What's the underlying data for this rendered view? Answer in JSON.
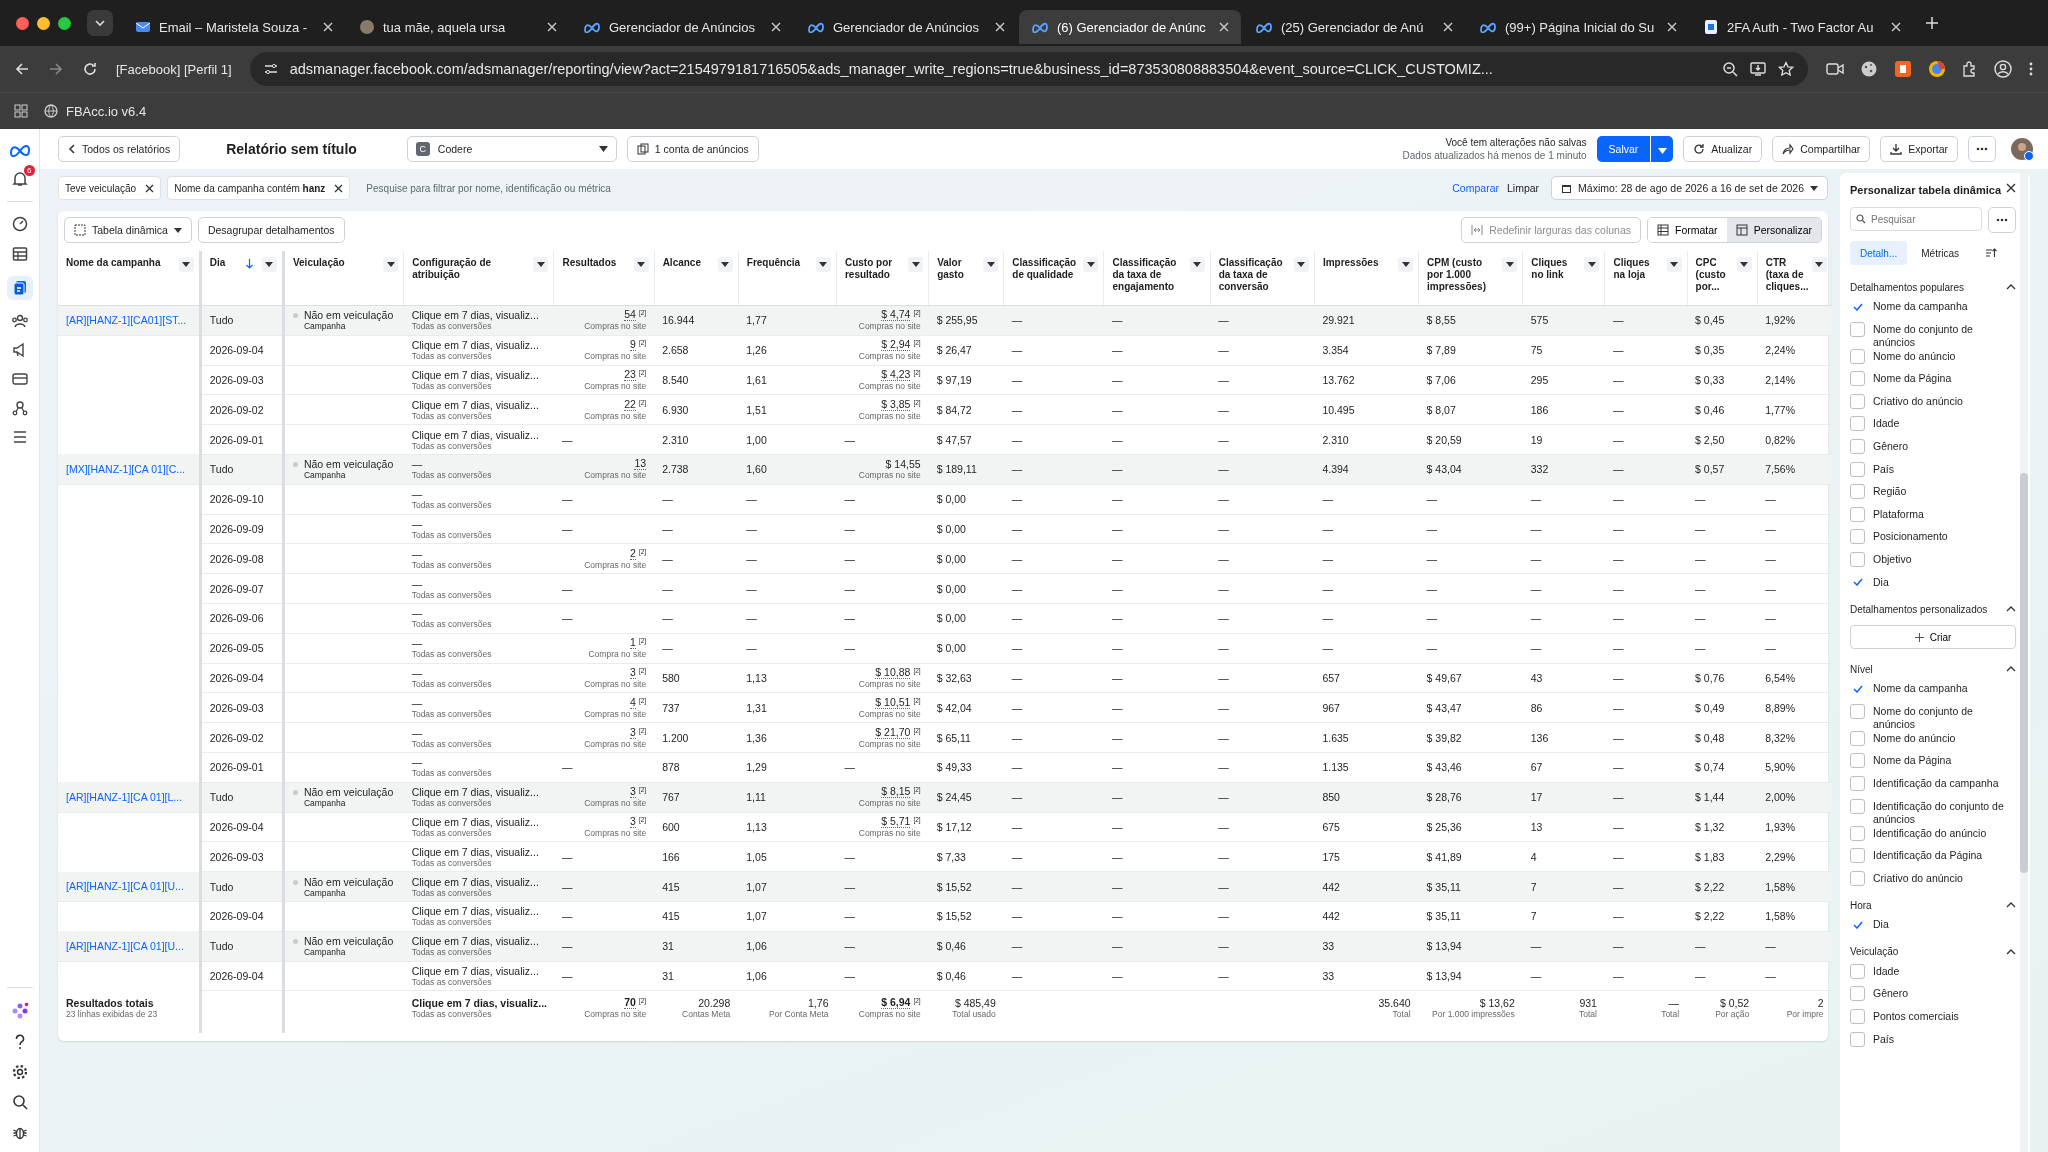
{
  "browser": {
    "tabs": [
      {
        "title": "Email – Maristela Souza -",
        "selected": false
      },
      {
        "title": "tua mãe, aquela ursa",
        "selected": false
      },
      {
        "title": "Gerenciador de Anúncios",
        "selected": false
      },
      {
        "title": "Gerenciador de Anúncios",
        "selected": false
      },
      {
        "title": "(6) Gerenciador de Anúnc",
        "selected": true
      },
      {
        "title": "(25) Gerenciador de Anú",
        "selected": false
      },
      {
        "title": "(99+) Página Inicial do Su",
        "selected": false
      },
      {
        "title": "2FA Auth - Two Factor Au",
        "selected": false
      }
    ],
    "profile": "[Facebook] [Perfil 1]",
    "url": "adsmanager.facebook.com/adsmanager/reporting/view?act=2154979181716505&ads_manager_write_regions=true&business_id=873530808883504&event_source=CLICK_CUSTOMIZ...",
    "bookmark": "FBAcc.io v6.4"
  },
  "nav": {
    "notifications": "6"
  },
  "header": {
    "back": "Todos os relatórios",
    "title": "Relatório sem título",
    "account": {
      "initial": "C",
      "name": "Codere"
    },
    "accounts_button": "1 conta de anúncios",
    "unsaved": "Você tem alterações não salvas",
    "updated": "Dados atualizados há menos de 1 minuto",
    "save": "Salvar",
    "refresh": "Atualizar",
    "share": "Compartilhar",
    "export": "Exportar"
  },
  "filters": {
    "chips": [
      "Teve veiculação",
      "Nome da campanha contém **hanz**"
    ],
    "placeholder": "Pesquise para filtrar por nome, identificação ou métrica",
    "compare": "Comparar",
    "clear": "Limpar",
    "date": "Máximo: 28 de ago de 2026 a 16 de set de 2026"
  },
  "toolbar": {
    "view": "Tabela dinâmica",
    "ungroup": "Desagrupar detalhamentos",
    "reset": "Redefinir larguras das colunas",
    "view_buttons": [
      {
        "label": "Formatar",
        "selected": false
      },
      {
        "label": "Personalizar",
        "selected": true
      }
    ]
  },
  "table": {
    "columns": [
      {
        "label": "Nome da campanha",
        "sorted": false
      },
      {
        "label": "Dia",
        "sorted": true
      },
      {
        "label": "Veiculação",
        "sorted": false
      },
      {
        "label": "Configuração de atribuição",
        "sorted": false
      },
      {
        "label": "Resultados",
        "sorted": false
      },
      {
        "label": "Alcance",
        "sorted": false
      },
      {
        "label": "Frequência",
        "sorted": false
      },
      {
        "label": "Custo por resultado",
        "sorted": false
      },
      {
        "label": "Valor gasto",
        "sorted": false
      },
      {
        "label": "Classificação de qualidade",
        "sorted": false
      },
      {
        "label": "Classificação da taxa de engajamento",
        "sorted": false
      },
      {
        "label": "Classificação da taxa de conversão",
        "sorted": false
      },
      {
        "label": "Impressões",
        "sorted": false
      },
      {
        "label": "CPM (custo por 1.000 impressões)",
        "sorted": false
      },
      {
        "label": "Cliques no link",
        "sorted": false
      },
      {
        "label": "Cliques na loja",
        "sorted": false
      },
      {
        "label": "CPC (custo por...",
        "sorted": false
      },
      {
        "label": "CTR (taxa de cliques...",
        "sorted": false
      }
    ],
    "rows": [
      {
        "campaign": "[AR][HANZ-1][CA01][ST...",
        "day": "Tudo",
        "delivery": {
          "status": "Não em veiculação",
          "level": "Campanha"
        },
        "attribution": {
          "text": "Clique em 7 dias, visualiz...",
          "sub": "Todas as conversões"
        },
        "results": {
          "value": "54",
          "note": "[2]",
          "sub": "Compras no site"
        },
        "reach": "16.944",
        "frequency": "1,77",
        "cost": {
          "value": "$ 4,74",
          "note": "[2]",
          "sub": "Compras no site"
        },
        "spent": "$ 255,95",
        "metrics": [
          "—",
          "—",
          "—",
          "29.921",
          "$ 8,55",
          "575",
          "—",
          "$ 0,45",
          "1,92%"
        ]
      },
      {
        "day": "2026-09-04",
        "attribution": {
          "text": "Clique em 7 dias, visualiz...",
          "sub": "Todas as conversões"
        },
        "results": {
          "value": "9",
          "note": "[2]",
          "sub": "Compras no site"
        },
        "reach": "2.658",
        "frequency": "1,26",
        "cost": {
          "value": "$ 2,94",
          "note": "[2]",
          "sub": "Compras no site"
        },
        "spent": "$ 26,47",
        "metrics": [
          "—",
          "—",
          "—",
          "3.354",
          "$ 7,89",
          "75",
          "—",
          "$ 0,35",
          "2,24%"
        ]
      },
      {
        "day": "2026-09-03",
        "attribution": {
          "text": "Clique em 7 dias, visualiz...",
          "sub": "Todas as conversões"
        },
        "results": {
          "value": "23",
          "note": "[2]",
          "sub": "Compras no site"
        },
        "reach": "8.540",
        "frequency": "1,61",
        "cost": {
          "value": "$ 4,23",
          "note": "[2]",
          "sub": "Compras no site"
        },
        "spent": "$ 97,19",
        "metrics": [
          "—",
          "—",
          "—",
          "13.762",
          "$ 7,06",
          "295",
          "—",
          "$ 0,33",
          "2,14%"
        ]
      },
      {
        "day": "2026-09-02",
        "attribution": {
          "text": "Clique em 7 dias, visualiz...",
          "sub": "Todas as conversões"
        },
        "results": {
          "value": "22",
          "note": "[2]",
          "sub": "Compras no site"
        },
        "reach": "6.930",
        "frequency": "1,51",
        "cost": {
          "value": "$ 3,85",
          "note": "[2]",
          "sub": "Compras no site"
        },
        "spent": "$ 84,72",
        "metrics": [
          "—",
          "—",
          "—",
          "10.495",
          "$ 8,07",
          "186",
          "—",
          "$ 0,46",
          "1,77%"
        ]
      },
      {
        "day": "2026-09-01",
        "attribution": {
          "text": "Clique em 7 dias, visualiz...",
          "sub": "Todas as conversões"
        },
        "results": {
          "value": "—"
        },
        "reach": "2.310",
        "frequency": "1,00",
        "cost": {
          "value": "—"
        },
        "spent": "$ 47,57",
        "metrics": [
          "—",
          "—",
          "—",
          "2.310",
          "$ 20,59",
          "19",
          "—",
          "$ 2,50",
          "0,82%"
        ]
      },
      {
        "campaign": "[MX][HANZ-1][CA 01][C...",
        "day": "Tudo",
        "delivery": {
          "status": "Não em veiculação",
          "level": "Campanha"
        },
        "attribution": {
          "text": "—",
          "sub": "Todas as conversões"
        },
        "results": {
          "value": "13",
          "sub": "Compras no site"
        },
        "reach": "2.738",
        "frequency": "1,60",
        "cost": {
          "value": "$ 14,55",
          "sub": "Compras no site"
        },
        "spent": "$ 189,11",
        "metrics": [
          "—",
          "—",
          "—",
          "4.394",
          "$ 43,04",
          "332",
          "—",
          "$ 0,57",
          "7,56%"
        ]
      },
      {
        "day": "2026-09-10",
        "attribution": {
          "text": "—",
          "sub": "Todas as conversões"
        },
        "results": {
          "value": "—"
        },
        "reach": "—",
        "frequency": "—",
        "cost": {
          "value": "—"
        },
        "spent": "$ 0,00",
        "metrics": [
          "—",
          "—",
          "—",
          "—",
          "—",
          "—",
          "—",
          "—",
          "—"
        ]
      },
      {
        "day": "2026-09-09",
        "attribution": {
          "text": "—",
          "sub": "Todas as conversões"
        },
        "results": {
          "value": "—"
        },
        "reach": "—",
        "frequency": "—",
        "cost": {
          "value": "—"
        },
        "spent": "$ 0,00",
        "metrics": [
          "—",
          "—",
          "—",
          "—",
          "—",
          "—",
          "—",
          "—",
          "—"
        ]
      },
      {
        "day": "2026-09-08",
        "attribution": {
          "text": "—",
          "sub": "Todas as conversões"
        },
        "results": {
          "value": "2",
          "note": "[2]",
          "sub": "Compras no site"
        },
        "reach": "—",
        "frequency": "—",
        "cost": {
          "value": "—"
        },
        "spent": "$ 0,00",
        "metrics": [
          "—",
          "—",
          "—",
          "—",
          "—",
          "—",
          "—",
          "—",
          "—"
        ]
      },
      {
        "day": "2026-09-07",
        "attribution": {
          "text": "—",
          "sub": "Todas as conversões"
        },
        "results": {
          "value": "—"
        },
        "reach": "—",
        "frequency": "—",
        "cost": {
          "value": "—"
        },
        "spent": "$ 0,00",
        "metrics": [
          "—",
          "—",
          "—",
          "—",
          "—",
          "—",
          "—",
          "—",
          "—"
        ]
      },
      {
        "day": "2026-09-06",
        "attribution": {
          "text": "—",
          "sub": "Todas as conversões"
        },
        "results": {
          "value": "—"
        },
        "reach": "—",
        "frequency": "—",
        "cost": {
          "value": "—"
        },
        "spent": "$ 0,00",
        "metrics": [
          "—",
          "—",
          "—",
          "—",
          "—",
          "—",
          "—",
          "—",
          "—"
        ]
      },
      {
        "day": "2026-09-05",
        "attribution": {
          "text": "—",
          "sub": "Todas as conversões"
        },
        "results": {
          "value": "1",
          "note": "[2]",
          "sub": "Compra no site"
        },
        "reach": "—",
        "frequency": "—",
        "cost": {
          "value": "—"
        },
        "spent": "$ 0,00",
        "metrics": [
          "—",
          "—",
          "—",
          "—",
          "—",
          "—",
          "—",
          "—",
          "—"
        ]
      },
      {
        "day": "2026-09-04",
        "attribution": {
          "text": "—",
          "sub": "Todas as conversões"
        },
        "results": {
          "value": "3",
          "note": "[2]",
          "sub": "Compras no site"
        },
        "reach": "580",
        "frequency": "1,13",
        "cost": {
          "value": "$ 10,88",
          "note": "[2]",
          "sub": "Compras no site"
        },
        "spent": "$ 32,63",
        "metrics": [
          "—",
          "—",
          "—",
          "657",
          "$ 49,67",
          "43",
          "—",
          "$ 0,76",
          "6,54%"
        ]
      },
      {
        "day": "2026-09-03",
        "attribution": {
          "text": "—",
          "sub": "Todas as conversões"
        },
        "results": {
          "value": "4",
          "note": "[2]",
          "sub": "Compras no site"
        },
        "reach": "737",
        "frequency": "1,31",
        "cost": {
          "value": "$ 10,51",
          "note": "[2]",
          "sub": "Compras no site"
        },
        "spent": "$ 42,04",
        "metrics": [
          "—",
          "—",
          "—",
          "967",
          "$ 43,47",
          "86",
          "—",
          "$ 0,49",
          "8,89%"
        ]
      },
      {
        "day": "2026-09-02",
        "attribution": {
          "text": "—",
          "sub": "Todas as conversões"
        },
        "results": {
          "value": "3",
          "note": "[2]",
          "sub": "Compras no site"
        },
        "reach": "1.200",
        "frequency": "1,36",
        "cost": {
          "value": "$ 21,70",
          "note": "[2]",
          "sub": "Compras no site"
        },
        "spent": "$ 65,11",
        "metrics": [
          "—",
          "—",
          "—",
          "1.635",
          "$ 39,82",
          "136",
          "—",
          "$ 0,48",
          "8,32%"
        ]
      },
      {
        "day": "2026-09-01",
        "attribution": {
          "text": "—",
          "sub": "Todas as conversões"
        },
        "results": {
          "value": "—"
        },
        "reach": "878",
        "frequency": "1,29",
        "cost": {
          "value": "—"
        },
        "spent": "$ 49,33",
        "metrics": [
          "—",
          "—",
          "—",
          "1.135",
          "$ 43,46",
          "67",
          "—",
          "$ 0,74",
          "5,90%"
        ]
      },
      {
        "campaign": "[AR][HANZ-1][CA 01][L...",
        "day": "Tudo",
        "delivery": {
          "status": "Não em veiculação",
          "level": "Campanha"
        },
        "attribution": {
          "text": "Clique em 7 dias, visualiz...",
          "sub": "Todas as conversões"
        },
        "results": {
          "value": "3",
          "note": "[2]",
          "sub": "Compras no site"
        },
        "reach": "767",
        "frequency": "1,11",
        "cost": {
          "value": "$ 8,15",
          "note": "[2]",
          "sub": "Compras no site"
        },
        "spent": "$ 24,45",
        "metrics": [
          "—",
          "—",
          "—",
          "850",
          "$ 28,76",
          "17",
          "—",
          "$ 1,44",
          "2,00%"
        ]
      },
      {
        "day": "2026-09-04",
        "attribution": {
          "text": "Clique em 7 dias, visualiz...",
          "sub": "Todas as conversões"
        },
        "results": {
          "value": "3",
          "note": "[2]",
          "sub": "Compras no site"
        },
        "reach": "600",
        "frequency": "1,13",
        "cost": {
          "value": "$ 5,71",
          "note": "[2]",
          "sub": "Compras no site"
        },
        "spent": "$ 17,12",
        "metrics": [
          "—",
          "—",
          "—",
          "675",
          "$ 25,36",
          "13",
          "—",
          "$ 1,32",
          "1,93%"
        ]
      },
      {
        "day": "2026-09-03",
        "attribution": {
          "text": "Clique em 7 dias, visualiz...",
          "sub": "Todas as conversões"
        },
        "results": {
          "value": "—"
        },
        "reach": "166",
        "frequency": "1,05",
        "cost": {
          "value": "—"
        },
        "spent": "$ 7,33",
        "metrics": [
          "—",
          "—",
          "—",
          "175",
          "$ 41,89",
          "4",
          "—",
          "$ 1,83",
          "2,29%"
        ]
      },
      {
        "campaign": "[AR][HANZ-1][CA 01][U...",
        "day": "Tudo",
        "delivery": {
          "status": "Não em veiculação",
          "level": "Campanha"
        },
        "attribution": {
          "text": "Clique em 7 dias, visualiz...",
          "sub": "Todas as conversões"
        },
        "results": {
          "value": "—"
        },
        "reach": "415",
        "frequency": "1,07",
        "cost": {
          "value": "—"
        },
        "spent": "$ 15,52",
        "metrics": [
          "—",
          "—",
          "—",
          "442",
          "$ 35,11",
          "7",
          "—",
          "$ 2,22",
          "1,58%"
        ]
      },
      {
        "day": "2026-09-04",
        "attribution": {
          "text": "Clique em 7 dias, visualiz...",
          "sub": "Todas as conversões"
        },
        "results": {
          "value": "—"
        },
        "reach": "415",
        "frequency": "1,07",
        "cost": {
          "value": "—"
        },
        "spent": "$ 15,52",
        "metrics": [
          "—",
          "—",
          "—",
          "442",
          "$ 35,11",
          "7",
          "—",
          "$ 2,22",
          "1,58%"
        ]
      },
      {
        "campaign": "[AR][HANZ-1][CA 01][U...",
        "day": "Tudo",
        "delivery": {
          "status": "Não em veiculação",
          "level": "Campanha"
        },
        "attribution": {
          "text": "Clique em 7 dias, visualiz...",
          "sub": "Todas as conversões"
        },
        "results": {
          "value": "—"
        },
        "reach": "31",
        "frequency": "1,06",
        "cost": {
          "value": "—"
        },
        "spent": "$ 0,46",
        "metrics": [
          "—",
          "—",
          "—",
          "33",
          "$ 13,94",
          "—",
          "—",
          "—",
          "—"
        ]
      },
      {
        "day": "2026-09-04",
        "attribution": {
          "text": "Clique em 7 dias, visualiz...",
          "sub": "Todas as conversões"
        },
        "results": {
          "value": "—"
        },
        "reach": "31",
        "frequency": "1,06",
        "cost": {
          "value": "—"
        },
        "spent": "$ 0,46",
        "metrics": [
          "—",
          "—",
          "—",
          "33",
          "$ 13,94",
          "—",
          "—",
          "—",
          "—"
        ]
      }
    ],
    "totals": {
      "label": "Resultados totais",
      "sub": "23 linhas exibidas de 23",
      "cells": [
        {},
        {
          "value": "Clique em 7 dias, visualiz...",
          "sub": "Todas as conversões"
        },
        {
          "value": "70",
          "note": "[2]",
          "sub": "Compras no site"
        },
        {
          "value": "20.298",
          "sub": "Contas Meta"
        },
        {
          "value": "1,76",
          "sub": "Por Conta Meta"
        },
        {
          "value": "$ 6,94",
          "note": "[2]",
          "sub": "Compras no site"
        },
        {
          "value": "$ 485,49",
          "sub": "Total usado"
        },
        {},
        {},
        {},
        {
          "value": "35.640",
          "sub": "Total"
        },
        {
          "value": "$ 13,62",
          "sub": "Por 1.000 impressões"
        },
        {
          "value": "931",
          "sub": "Total"
        },
        {
          "value": "—",
          "sub": "Total"
        },
        {
          "value": "$ 0,52",
          "sub": "Por ação"
        },
        {
          "value": "2",
          "sub": "Por impre"
        }
      ]
    }
  },
  "panel": {
    "title": "Personalizar tabela dinâmica",
    "search_placeholder": "Pesquisar",
    "tabs": [
      {
        "label": "Detalh...",
        "selected": true
      },
      {
        "label": "Métricas",
        "selected": false
      }
    ],
    "sections": [
      {
        "title": "Detalhamentos populares",
        "expanded": true,
        "items": [
          {
            "label": "Nome da campanha",
            "checked": true
          },
          {
            "label": "Nome do conjunto de anúncios",
            "checked": false
          },
          {
            "label": "Nome do anúncio",
            "checked": false
          },
          {
            "label": "Nome da Página",
            "checked": false
          },
          {
            "label": "Criativo do anúncio",
            "checked": false
          },
          {
            "label": "Idade",
            "checked": false
          },
          {
            "label": "Gênero",
            "checked": false
          },
          {
            "label": "País",
            "checked": false
          },
          {
            "label": "Região",
            "checked": false
          },
          {
            "label": "Plataforma",
            "checked": false
          },
          {
            "label": "Posicionamento",
            "checked": false
          },
          {
            "label": "Objetivo",
            "checked": false
          },
          {
            "label": "Dia",
            "checked": true
          }
        ]
      },
      {
        "title": "Detalhamentos personalizados",
        "expanded": true,
        "button": "Criar"
      },
      {
        "title": "Nível",
        "expanded": true,
        "items": [
          {
            "label": "Nome da campanha",
            "checked": true
          },
          {
            "label": "Nome do conjunto de anúncios",
            "checked": false
          },
          {
            "label": "Nome do anúncio",
            "checked": false
          },
          {
            "label": "Nome da Página",
            "checked": false
          },
          {
            "label": "Identificação da campanha",
            "checked": false
          },
          {
            "label": "Identificação do conjunto de anúncios",
            "checked": false
          },
          {
            "label": "Identificação do anúncio",
            "checked": false
          },
          {
            "label": "Identificação da Página",
            "checked": false
          },
          {
            "label": "Criativo do anúncio",
            "checked": false
          }
        ]
      },
      {
        "title": "Hora",
        "expanded": true,
        "items": [
          {
            "label": "Dia",
            "checked": true
          }
        ]
      },
      {
        "title": "Veiculação",
        "expanded": true,
        "items": [
          {
            "label": "Idade",
            "checked": false
          },
          {
            "label": "Gênero",
            "checked": false
          },
          {
            "label": "Pontos comerciais",
            "checked": false
          },
          {
            "label": "País",
            "checked": false
          }
        ]
      }
    ]
  }
}
